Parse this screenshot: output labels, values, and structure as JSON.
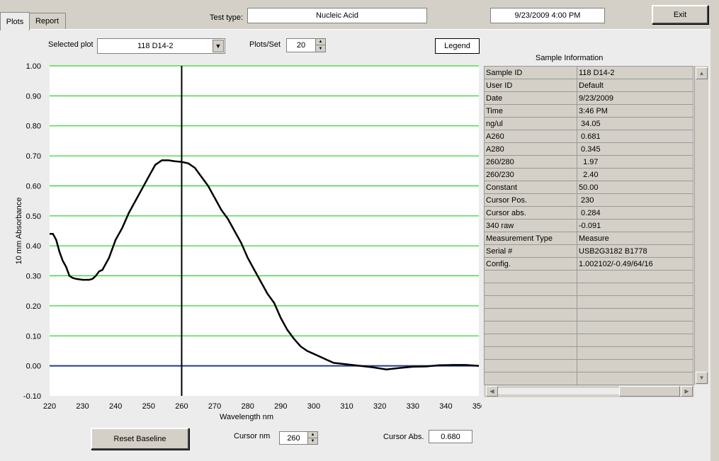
{
  "tabs": [
    {
      "label": "Plots"
    },
    {
      "label": "Report"
    }
  ],
  "header": {
    "test_type_label": "Test type:",
    "test_type_value": "Nucleic Acid",
    "datetime": "9/23/2009  4:00 PM",
    "exit_label": "Exit"
  },
  "controls": {
    "selected_plot_label": "Selected plot",
    "selected_plot_value": "118 D14-2",
    "plots_per_set_label": "Plots/Set",
    "plots_per_set_value": "20",
    "legend_label": "Legend"
  },
  "sample_info": {
    "title": "Sample Information",
    "rows": [
      {
        "key": "Sample ID",
        "value": "118 D14-2"
      },
      {
        "key": "User ID",
        "value": "Default"
      },
      {
        "key": "Date",
        "value": "9/23/2009"
      },
      {
        "key": "Time",
        "value": "3:46 PM"
      },
      {
        "key": "ng/ul",
        "value": " 34.05"
      },
      {
        "key": "A260",
        "value": " 0.681"
      },
      {
        "key": "A280",
        "value": " 0.345"
      },
      {
        "key": "260/280",
        "value": "  1.97"
      },
      {
        "key": "260/230",
        "value": "  2.40"
      },
      {
        "key": "Constant",
        "value": "50.00"
      },
      {
        "key": "Cursor Pos.",
        "value": " 230"
      },
      {
        "key": "Cursor abs.",
        "value": " 0.284"
      },
      {
        "key": "340 raw",
        "value": "-0.091"
      },
      {
        "key": "Measurement Type",
        "value": "Measure"
      },
      {
        "key": "Serial #",
        "value": "USB2G3182 B1778"
      },
      {
        "key": "Config.",
        "value": "1.002102/-0.49/64/16"
      }
    ],
    "empty_rows": 9
  },
  "bottom": {
    "reset_baseline_label": "Reset Baseline",
    "cursor_nm_label": "Cursor nm",
    "cursor_nm_value": "260",
    "cursor_abs_label": "Cursor Abs.",
    "cursor_abs_value": "0.680"
  },
  "chart_data": {
    "type": "line",
    "xlabel": "Wavelength nm",
    "ylabel": "10 mm Absorbance",
    "xlim": [
      220,
      350
    ],
    "ylim": [
      -0.1,
      1.0
    ],
    "xticks": [
      220,
      230,
      240,
      250,
      260,
      270,
      280,
      290,
      300,
      310,
      320,
      330,
      340,
      350
    ],
    "xtick_labels": [
      "220",
      "230",
      "240",
      "250",
      "260",
      "270",
      "280",
      "290",
      "300",
      "310",
      "320",
      "330",
      "340",
      "350"
    ],
    "yticks": [
      -0.1,
      0,
      0.1,
      0.2,
      0.3,
      0.4,
      0.5,
      0.6,
      0.7,
      0.8,
      0.9,
      1.0
    ],
    "ytick_labels": [
      "-0.10",
      "0.00",
      "0.10",
      "0.20",
      "0.30",
      "0.40",
      "0.50",
      "0.60",
      "0.70",
      "0.80",
      "0.90",
      "1.00"
    ],
    "grid_color": "#00c800",
    "line_color": "#000000",
    "baseline_color": "#1f3c88",
    "cursor_x": 260,
    "x": [
      220,
      221,
      222,
      223,
      224,
      225,
      226,
      227,
      228,
      230,
      232,
      233,
      234,
      235,
      236,
      238,
      240,
      242,
      244,
      246,
      248,
      250,
      252,
      254,
      256,
      258,
      260,
      262,
      264,
      266,
      268,
      270,
      272,
      274,
      276,
      278,
      280,
      282,
      284,
      286,
      288,
      290,
      292,
      294,
      296,
      298,
      300,
      302,
      304,
      306,
      310,
      314,
      318,
      322,
      326,
      330,
      334,
      338,
      342,
      346,
      350
    ],
    "y": [
      0.44,
      0.44,
      0.42,
      0.38,
      0.35,
      0.33,
      0.3,
      0.293,
      0.29,
      0.287,
      0.287,
      0.29,
      0.3,
      0.315,
      0.32,
      0.36,
      0.42,
      0.46,
      0.51,
      0.55,
      0.59,
      0.63,
      0.67,
      0.685,
      0.685,
      0.682,
      0.68,
      0.675,
      0.66,
      0.63,
      0.6,
      0.56,
      0.52,
      0.49,
      0.45,
      0.41,
      0.36,
      0.32,
      0.28,
      0.24,
      0.21,
      0.16,
      0.12,
      0.09,
      0.065,
      0.05,
      0.04,
      0.03,
      0.02,
      0.01,
      0.005,
      0.0,
      -0.005,
      -0.012,
      -0.007,
      -0.003,
      -0.002,
      0.002,
      0.003,
      0.003,
      0.0
    ]
  }
}
